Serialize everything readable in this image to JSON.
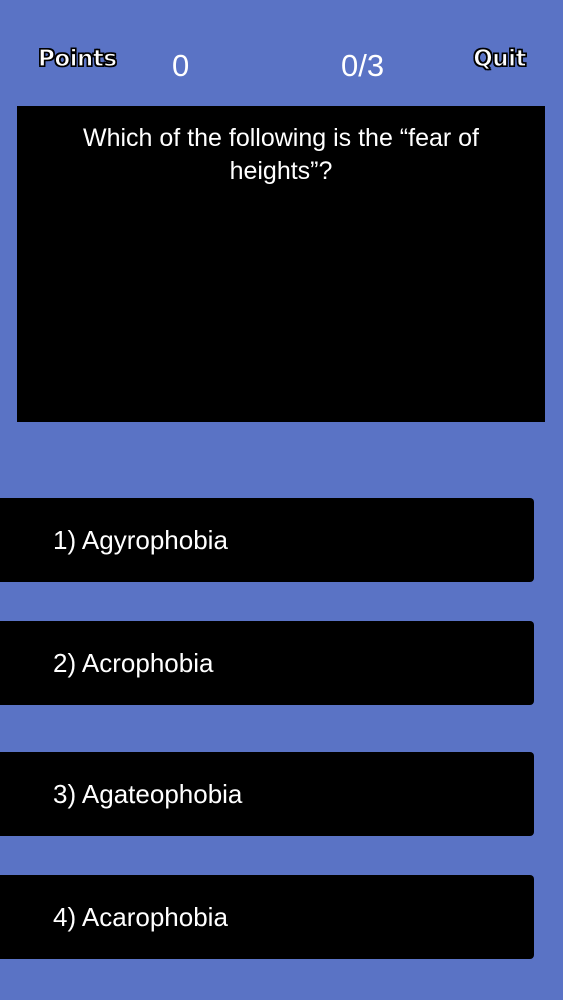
{
  "hud": {
    "points_label": "Points",
    "score": "0",
    "progress": "0/3",
    "quit_label": "Quit"
  },
  "question": {
    "text": "Which of the following is the “fear of heights”?"
  },
  "answers": [
    {
      "label": "1) Agyrophobia"
    },
    {
      "label": "2) Acrophobia"
    },
    {
      "label": "3) Agateophobia"
    },
    {
      "label": "4) Acarophobia"
    }
  ],
  "colors": {
    "background": "#5a73c5",
    "panel": "#000000",
    "text": "#ffffff"
  }
}
